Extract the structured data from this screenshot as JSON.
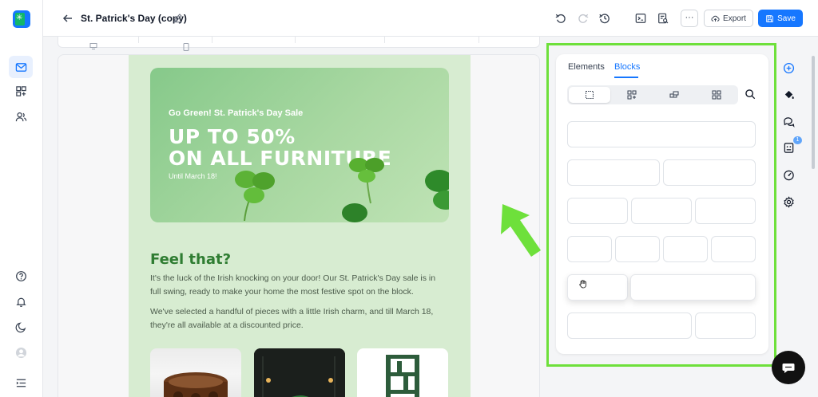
{
  "app": {
    "logo_name": "app-logo",
    "logo_letter": "E"
  },
  "header": {
    "title": "St. Patrick's Day (copy)",
    "more_label": "···",
    "export_label": "Export",
    "save_label": "Save"
  },
  "sidebar_left": {
    "items": [
      "mail-icon",
      "blocks-icon",
      "contacts-icon"
    ],
    "bottom": [
      "help-icon",
      "bell-icon",
      "moon-icon",
      "user-avatar",
      "menu-collapse-icon"
    ]
  },
  "email": {
    "hero": {
      "kicker": "Go Green! St. Patrick's Day Sale",
      "headline_line1": "UP TO 50%",
      "headline_line2": "ON ALL FURNITURE",
      "sub": "Until March 18!"
    },
    "section_title": "Feel that?",
    "para1_line1": "It's the luck of the Irish knocking on your door! Our St. Patrick's Day sale is in",
    "para1_line2": "full swing, ready to make your home the most festive spot on the block.",
    "para2_line1": "We've selected a handful of pieces with a little Irish charm, and till March 18,",
    "para2_line2": "they're all available at a discounted price."
  },
  "panel": {
    "tabs": [
      "Elements",
      "Blocks"
    ],
    "active_tab": "Blocks",
    "segments": [
      "single-column-icon",
      "two-column-icon",
      "mixed-layout-icon",
      "grid-icon"
    ]
  },
  "right_rail": {
    "badge_count": "1"
  },
  "colors": {
    "accent": "#1677ff",
    "highlight": "#6ee03b",
    "email_bg": "#d7ecd1",
    "section_title": "#2f7d32"
  }
}
